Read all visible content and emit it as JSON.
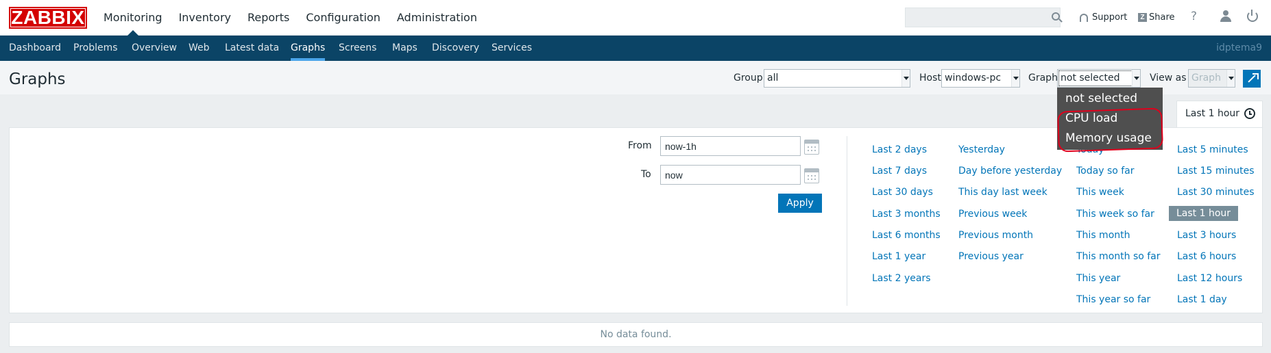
{
  "header": {
    "logo_text": "ZABBIX",
    "main_menu": [
      "Monitoring",
      "Inventory",
      "Reports",
      "Configuration",
      "Administration"
    ],
    "search_placeholder": "",
    "support_label": "Support",
    "share_label": "Share",
    "help_label": "?"
  },
  "subnav": {
    "items": [
      "Dashboard",
      "Problems",
      "Overview",
      "Web",
      "Latest data",
      "Graphs",
      "Screens",
      "Maps",
      "Discovery",
      "Services"
    ],
    "active": "Graphs",
    "username": "idptema9"
  },
  "titlebar": {
    "title": "Graphs",
    "group_label": "Group",
    "group_value": "all",
    "host_label": "Host",
    "host_value": "windows-pc",
    "graph_label": "Graph",
    "graph_value": "not selected",
    "viewas_label": "View as",
    "viewas_value": "Graph"
  },
  "graph_dropdown": {
    "options": [
      "not selected",
      "CPU load",
      "Memory usage"
    ]
  },
  "time_tab": {
    "label": "Last 1 hour"
  },
  "filter": {
    "from_label": "From",
    "from_value": "now-1h",
    "to_label": "To",
    "to_value": "now",
    "apply_label": "Apply",
    "quick_ranges": {
      "col1": [
        "Last 2 days",
        "Last 7 days",
        "Last 30 days",
        "Last 3 months",
        "Last 6 months",
        "Last 1 year",
        "Last 2 years"
      ],
      "col2": [
        "Yesterday",
        "Day before yesterday",
        "This day last week",
        "Previous week",
        "Previous month",
        "Previous year"
      ],
      "col3": [
        "Today",
        "Today so far",
        "This week",
        "This week so far",
        "This month",
        "This month so far",
        "This year",
        "This year so far"
      ],
      "col4": [
        "Last 5 minutes",
        "Last 15 minutes",
        "Last 30 minutes",
        "Last 1 hour",
        "Last 3 hours",
        "Last 6 hours",
        "Last 12 hours",
        "Last 1 day"
      ]
    },
    "selected_range": "Last 1 hour"
  },
  "results": {
    "empty_message": "No data found."
  },
  "colors": {
    "brand_red": "#d40000",
    "nav_blue": "#0b4466",
    "link_blue": "#0275b8",
    "annotation_red": "#e0001c"
  }
}
